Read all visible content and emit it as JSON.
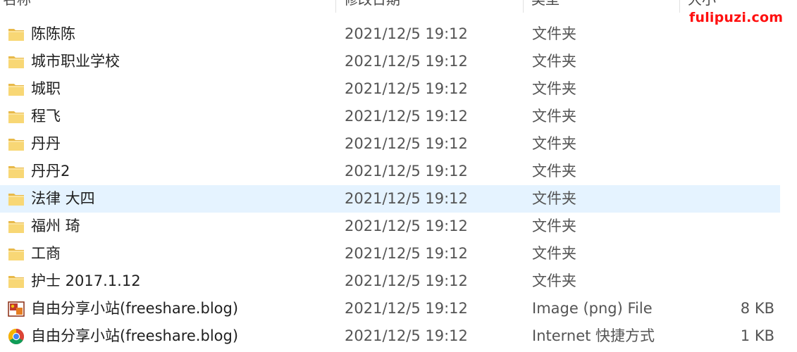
{
  "columns": {
    "name": "名称",
    "modified": "修改日期",
    "type": "类型",
    "size": "大小"
  },
  "watermark": "fulipuzi.com",
  "files": [
    {
      "name": "陈陈陈",
      "modified": "2021/12/5 19:12",
      "type": "文件夹",
      "size": "",
      "icon": "folder-icon"
    },
    {
      "name": "城市职业学校",
      "modified": "2021/12/5 19:12",
      "type": "文件夹",
      "size": "",
      "icon": "folder-icon"
    },
    {
      "name": "城职",
      "modified": "2021/12/5 19:12",
      "type": "文件夹",
      "size": "",
      "icon": "folder-icon"
    },
    {
      "name": "程飞",
      "modified": "2021/12/5 19:12",
      "type": "文件夹",
      "size": "",
      "icon": "folder-icon"
    },
    {
      "name": "丹丹",
      "modified": "2021/12/5 19:12",
      "type": "文件夹",
      "size": "",
      "icon": "folder-icon"
    },
    {
      "name": "丹丹2",
      "modified": "2021/12/5 19:12",
      "type": "文件夹",
      "size": "",
      "icon": "folder-icon"
    },
    {
      "name": "法律 大四",
      "modified": "2021/12/5 19:12",
      "type": "文件夹",
      "size": "",
      "icon": "folder-icon",
      "selected": true
    },
    {
      "name": "福州 琦",
      "modified": "2021/12/5 19:12",
      "type": "文件夹",
      "size": "",
      "icon": "folder-icon"
    },
    {
      "name": "工商",
      "modified": "2021/12/5 19:12",
      "type": "文件夹",
      "size": "",
      "icon": "folder-icon"
    },
    {
      "name": "护士 2017.1.12",
      "modified": "2021/12/5 19:12",
      "type": "文件夹",
      "size": "",
      "icon": "folder-icon"
    },
    {
      "name": "自由分享小站(freeshare.blog)",
      "modified": "2021/12/5 19:12",
      "type": "Image (png) File",
      "size": "8 KB",
      "icon": "png-image-icon"
    },
    {
      "name": "自由分享小站(freeshare.blog)",
      "modified": "2021/12/5 19:12",
      "type": "Internet 快捷方式",
      "size": "1 KB",
      "icon": "chrome-shortcut-icon"
    }
  ],
  "colors": {
    "folder": "#f8d775",
    "folder_dark": "#e8b94a",
    "selected_row": "#e5f3ff",
    "watermark": "#ff1010"
  }
}
